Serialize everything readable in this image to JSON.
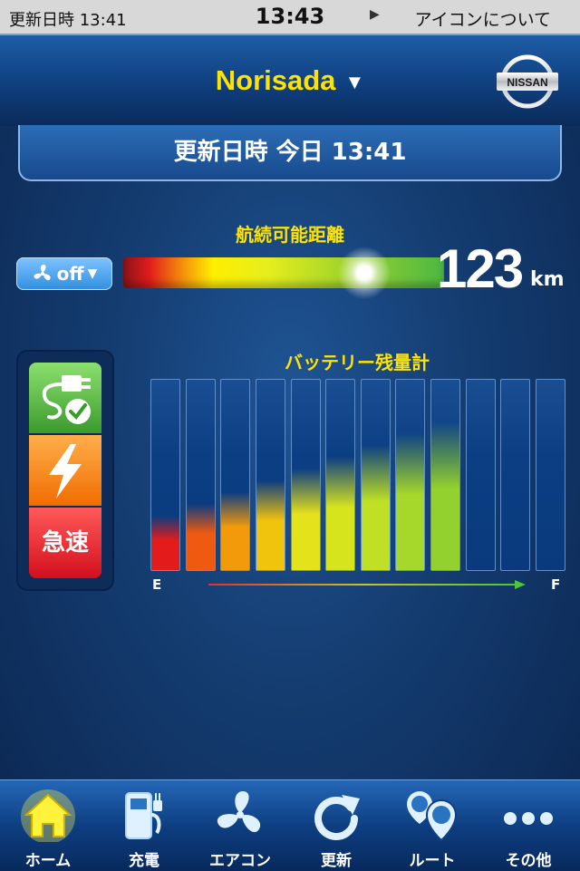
{
  "status_bar": {
    "left_text": "更新日時 13:41",
    "time": "13:43",
    "right_text": "アイコンについて"
  },
  "header": {
    "vehicle_name": "Norisada",
    "brand_logo_text": "NISSAN"
  },
  "update_banner": {
    "text": "更新日時 今日 13:41"
  },
  "range": {
    "title": "航続可能距離",
    "value": "123",
    "unit": "km",
    "indicator_fraction": 0.75
  },
  "climate": {
    "label": "off"
  },
  "charge_status": {
    "quick_label": "急速"
  },
  "battery": {
    "title": "バッテリー残量計",
    "label_empty": "E",
    "label_full": "F",
    "segments_total": 12,
    "segments_filled": 9,
    "colors": [
      "#e31b1b",
      "#f05a10",
      "#f39a0b",
      "#f0c30c",
      "#e4e21a",
      "#d6e41e",
      "#bfe024",
      "#a5d82a",
      "#93d12e"
    ]
  },
  "tab_bar": {
    "tabs": [
      {
        "id": "home",
        "label": "ホーム",
        "icon": "home-icon",
        "active": true
      },
      {
        "id": "charge",
        "label": "充電",
        "icon": "charger-icon",
        "active": false
      },
      {
        "id": "aircon",
        "label": "エアコン",
        "icon": "fan-icon",
        "active": false
      },
      {
        "id": "refresh",
        "label": "更新",
        "icon": "refresh-icon",
        "active": false
      },
      {
        "id": "route",
        "label": "ルート",
        "icon": "route-ab-icon",
        "active": false
      },
      {
        "id": "more",
        "label": "その他",
        "icon": "more-dots-icon",
        "active": false
      }
    ]
  }
}
